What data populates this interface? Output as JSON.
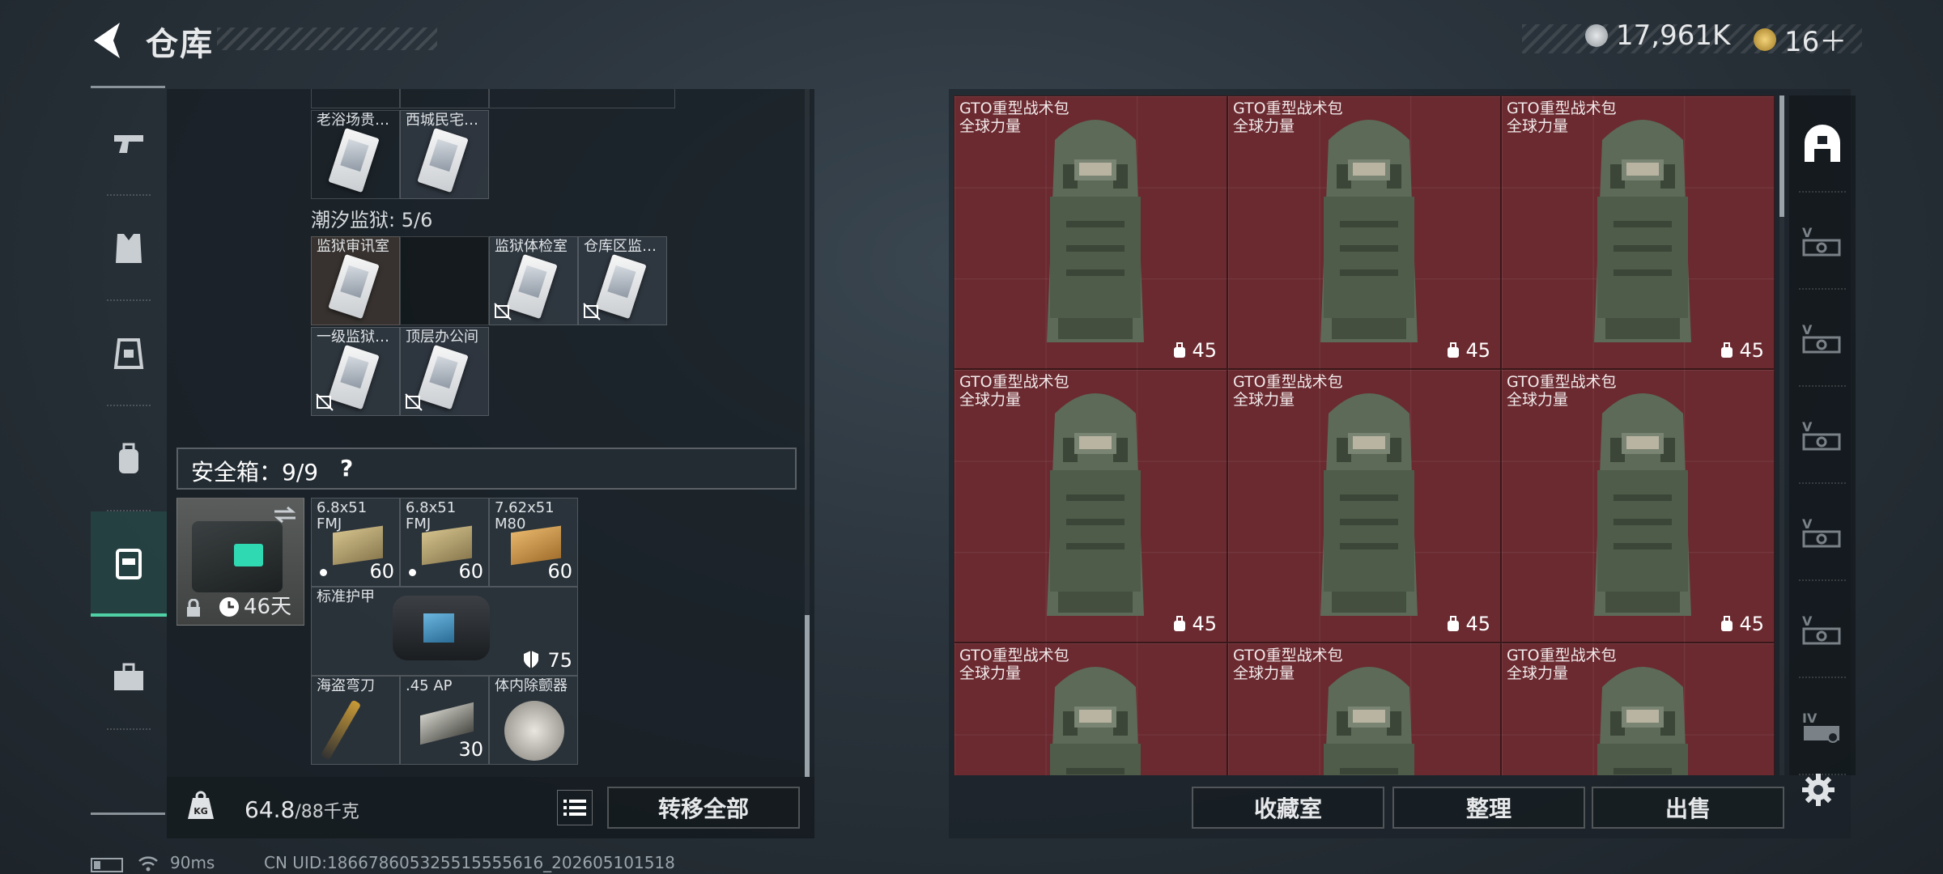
{
  "header": {
    "title": "仓库",
    "currency_main": "17,961K",
    "currency_secondary": "16＋"
  },
  "sidebar": {
    "items": [
      {
        "icon": "pistol-icon"
      },
      {
        "icon": "armor-vest-icon"
      },
      {
        "icon": "chest-rig-icon"
      },
      {
        "icon": "backpack-icon"
      },
      {
        "icon": "safe-case-icon",
        "active": true
      },
      {
        "icon": "toolbox-icon"
      }
    ]
  },
  "stash": {
    "top_row": [
      {
        "name": "老浴场贵…"
      },
      {
        "name": "西城民宅…"
      }
    ],
    "prison_label": "潮汐监狱: 5/6",
    "prison_items": [
      {
        "name": "监狱审讯室",
        "sealed": false
      },
      {
        "name": "",
        "empty": true
      },
      {
        "name": "监狱体检室",
        "sealed": true
      },
      {
        "name": "仓库区监…",
        "sealed": true
      },
      {
        "name": "一级监狱…",
        "sealed": true
      },
      {
        "name": "顶层办公间",
        "sealed": true
      }
    ],
    "safe_label": "安全箱：9/9",
    "safe_help": "?",
    "safe_case": {
      "timer": "46天"
    },
    "safe_items": [
      {
        "name": "6.8x51 FMJ",
        "count": "60",
        "dot": true
      },
      {
        "name": "6.8x51 FMJ",
        "count": "60",
        "dot": true
      },
      {
        "name": "7.62x51 M80",
        "count": "60"
      },
      {
        "name": "标准护甲",
        "count": "75"
      },
      {
        "name": "海盗弯刀",
        "count": ""
      },
      {
        "name": ".45 AP",
        "count": "30"
      },
      {
        "name": "体内除颤器",
        "count": ""
      }
    ]
  },
  "weight": {
    "current": "64.8",
    "max": "/88千克"
  },
  "buttons": {
    "transfer_all": "转移全部",
    "collection": "收藏室",
    "sort": "整理",
    "sell": "出售"
  },
  "container": {
    "items": [
      {
        "name": "GTO重型战术包",
        "sub": "全球力量",
        "count": "45"
      },
      {
        "name": "GTO重型战术包",
        "sub": "全球力量",
        "count": "45"
      },
      {
        "name": "GTO重型战术包",
        "sub": "全球力量",
        "count": "45"
      },
      {
        "name": "GTO重型战术包",
        "sub": "全球力量",
        "count": "45"
      },
      {
        "name": "GTO重型战术包",
        "sub": "全球力量",
        "count": "45"
      },
      {
        "name": "GTO重型战术包",
        "sub": "全球力量",
        "count": "45"
      },
      {
        "name": "GTO重型战术包",
        "sub": "全球力量",
        "count": ""
      },
      {
        "name": "GTO重型战术包",
        "sub": "全球力量",
        "count": ""
      },
      {
        "name": "GTO重型战术包",
        "sub": "全球力量",
        "count": ""
      }
    ]
  },
  "right_sidebar": {
    "items": [
      "home-storage-icon",
      "v-card-icon",
      "v-card-icon",
      "v-card-icon",
      "v-card-icon",
      "v-card-icon",
      "iv-card-icon"
    ]
  },
  "status": {
    "ping": "90ms",
    "uid": "CN UID:18667860532551555561​6_202605101518"
  }
}
